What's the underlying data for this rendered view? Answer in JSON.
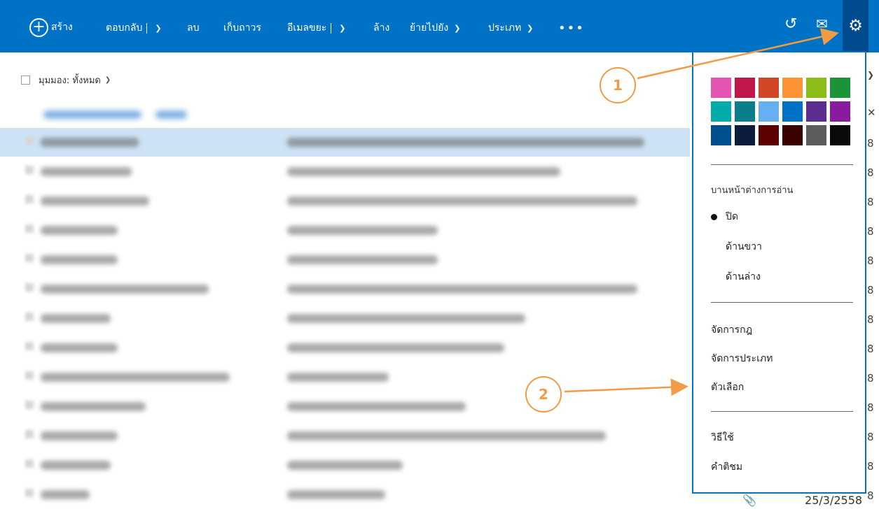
{
  "toolbar": {
    "new_label": "สร้าง",
    "reply_label": "ตอบกลับ",
    "delete_label": "ลบ",
    "archive_label": "เก็บถาวร",
    "junk_label": "อีเมลขยะ",
    "sweep_label": "ล้าง",
    "move_label": "ย้ายไปยัง",
    "category_label": "ประเภท",
    "more_label": "•••",
    "undo_icon": "undo-icon",
    "chat_icon": "chat-icon",
    "settings_icon": "gear-icon",
    "background_color": "#0072c6",
    "gear_active_color": "#004b8d"
  },
  "list_header": {
    "view_label": "มุมมอง: ทั้งหมด"
  },
  "mail_list": {
    "date_visible": "25/3/2558",
    "edge_chars": [
      "8",
      "8",
      "8",
      "8",
      "8",
      "8",
      "8",
      "8",
      "8",
      "8",
      "8",
      "8",
      "8"
    ]
  },
  "options_menu": {
    "theme_colors": [
      "#e354b3",
      "#c1184b",
      "#d24726",
      "#fe9334",
      "#8cbd18",
      "#1b9339",
      "#00aba9",
      "#0c7d8a",
      "#66b0f2",
      "#0072c6",
      "#5c2d91",
      "#8b1b9e",
      "#004e8c",
      "#0e1c3c",
      "#5c0000",
      "#3a0000",
      "#5c5c5c",
      "#0a0a0a"
    ],
    "reading_pane_heading": "บานหน้าต่างการอ่าน",
    "reading_pane_options": [
      "ปิด",
      "ด้านขวา",
      "ด้านล่าง"
    ],
    "reading_pane_selected": "ปิด",
    "manage_rules": "จัดการกฎ",
    "manage_categories": "จัดการประเภท",
    "options": "ตัวเลือก",
    "help": "วิธีใช้",
    "feedback": "คำติชม"
  },
  "annotations": {
    "callout_1": "1",
    "callout_2": "2",
    "color": "#f29b45"
  }
}
